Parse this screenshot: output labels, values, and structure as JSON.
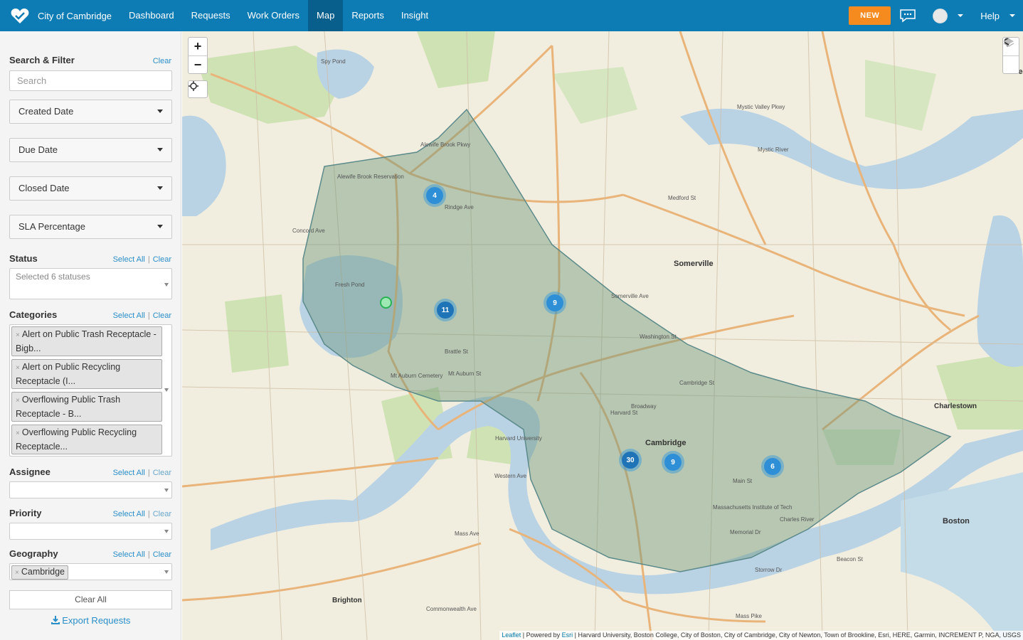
{
  "app": {
    "name": "City of Cambridge",
    "nav": [
      "Dashboard",
      "Requests",
      "Work Orders",
      "Map",
      "Reports",
      "Insight"
    ],
    "active_nav": "Map",
    "new_label": "NEW",
    "help_label": "Help"
  },
  "sidebar": {
    "search_filter_title": "Search & Filter",
    "clear": "Clear",
    "search_placeholder": "Search",
    "date_filters": [
      "Created Date",
      "Due Date",
      "Closed Date",
      "SLA Percentage"
    ],
    "select_all": "Select All",
    "status": {
      "title": "Status",
      "value": "Selected 6 statuses"
    },
    "categories": {
      "title": "Categories",
      "tags": [
        "Alert on Public Trash Receptacle - Bigb...",
        "Alert on Public Recycling Receptacle (I...",
        "Overflowing Public Trash Receptacle - B...",
        "Overflowing Public Recycling Receptacle..."
      ]
    },
    "assignee": {
      "title": "Assignee"
    },
    "priority": {
      "title": "Priority"
    },
    "geography": {
      "title": "Geography",
      "tag": "Cambridge"
    },
    "clear_all": "Clear All",
    "export": "Export Requests"
  },
  "map": {
    "clusters": [
      {
        "count": "4"
      },
      {
        "count": "11"
      },
      {
        "count": "9"
      },
      {
        "count": "30"
      },
      {
        "count": "9"
      },
      {
        "count": "6"
      }
    ],
    "places": {
      "somerville": "Somerville",
      "cambridge": "Cambridge",
      "charlestown": "Charlestown",
      "boston": "Boston",
      "brighton": "Brighton",
      "eve": "Eve"
    },
    "street_labels": {
      "fresh_pond": "Fresh Pond",
      "spy_pond": "Spy Pond",
      "mystic_river": "Mystic River",
      "harvard_university": "Harvard University",
      "charles_river": "Charles River",
      "mass_ave": "Mass Ave",
      "concord_ave": "Concord Ave",
      "broadway": "Broadway",
      "cambridge_st": "Cambridge St",
      "memorial_dr": "Memorial Dr",
      "western_ave": "Western Ave",
      "rindge_ave": "Rindge Ave",
      "mt_auburn_st": "Mt Auburn St",
      "washington_st": "Washington St",
      "harvard_st": "Harvard St",
      "beacon_st": "Beacon St",
      "commonwealth_ave": "Commonwealth Ave",
      "mass_pike": "Mass Pike",
      "alewife_brook_pkwy": "Alewife Brook Pkwy",
      "mystic_valley_pkwy": "Mystic Valley Pkwy",
      "medford_st": "Medford St",
      "somerville_ave": "Somerville Ave",
      "main_st": "Main St",
      "storrow_dr": "Storrow Dr",
      "brattle_st": "Brattle St",
      "alewife_brook_reservation": "Alewife Brook Reservation",
      "mit": "Massachusetts Institute of Tech",
      "mt_auburn_cemetery": "Mt Auburn Cemetery"
    },
    "attribution": {
      "leaflet": "Leaflet",
      "powered_by": " | Powered by ",
      "esri": "Esri",
      "sources": " | Harvard University, Boston College, City of Boston, City of Cambridge, City of Newton, Town of Brookline, Esri, HERE, Garmin, INCREMENT P, NGA, USGS"
    }
  },
  "colors": {
    "nav_bg": "#0d7bb4",
    "new_button": "#f58a1f",
    "cluster": "#2f8fd6",
    "boundary_fill": "#7fa38a"
  }
}
